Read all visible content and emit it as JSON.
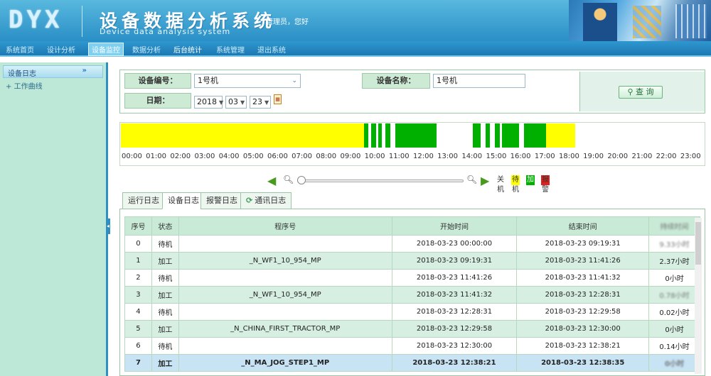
{
  "header": {
    "logo": "DYX",
    "title": "设备数据分析系统",
    "subtitle": "Device data analysis system",
    "greeting": "管理员，您好"
  },
  "nav": {
    "items": [
      "系统首页",
      "设计分析",
      "设备监控",
      "数据分析",
      "后台统计",
      "系统管理",
      "退出系统"
    ],
    "active_index": 2
  },
  "sidebar": {
    "header": "设备日志",
    "items": [
      "工作曲线"
    ]
  },
  "form": {
    "device_no_label": "设备编号：",
    "device_no_value": "1号机",
    "device_name_label": "设备名称：",
    "device_name_value": "1号机",
    "date_label": "日期：",
    "year": "2018",
    "month": "03",
    "day": "23",
    "query_label": "查 询"
  },
  "timeline": {
    "hours": [
      "00:00",
      "01:00",
      "02:00",
      "03:00",
      "04:00",
      "05:00",
      "06:00",
      "07:00",
      "08:00",
      "09:00",
      "10:00",
      "11:00",
      "12:00",
      "13:00",
      "14:00",
      "15:00",
      "16:00",
      "17:00",
      "18:00",
      "19:00",
      "20:00",
      "21:00",
      "22:00",
      "23:00"
    ],
    "segments": [
      {
        "start": 0.0,
        "end": 10.0,
        "state": "待机"
      },
      {
        "start": 10.0,
        "end": 10.2,
        "state": "加工"
      },
      {
        "start": 10.3,
        "end": 10.5,
        "state": "加工"
      },
      {
        "start": 10.6,
        "end": 10.75,
        "state": "加工"
      },
      {
        "start": 10.9,
        "end": 11.1,
        "state": "加工"
      },
      {
        "start": 11.3,
        "end": 11.9,
        "state": "加工"
      },
      {
        "start": 11.9,
        "end": 13.0,
        "state": "加工"
      },
      {
        "start": 14.5,
        "end": 14.8,
        "state": "加工"
      },
      {
        "start": 15.0,
        "end": 15.2,
        "state": "加工"
      },
      {
        "start": 15.4,
        "end": 15.6,
        "state": "加工"
      },
      {
        "start": 15.7,
        "end": 16.4,
        "state": "加工"
      },
      {
        "start": 16.6,
        "end": 17.5,
        "state": "加工"
      },
      {
        "start": 17.5,
        "end": 18.7,
        "state": "待机"
      }
    ],
    "colors": {
      "关机": "#ffffff",
      "待机": "#ffff00",
      "加工": "#00b000",
      "报警": "#e02020"
    }
  },
  "legend": [
    {
      "label": "关机",
      "bg": "#ffffff",
      "color": "#333333"
    },
    {
      "label": "待机",
      "bg": "#ffff00",
      "color": "#333333"
    },
    {
      "label": "加工",
      "bg": "#00b000",
      "color": "#ffffff"
    },
    {
      "label": "报警",
      "bg": "#e02020",
      "color": "#333333"
    }
  ],
  "tabs": [
    {
      "label": "运行日志",
      "active": false
    },
    {
      "label": "设备日志",
      "active": true
    },
    {
      "label": "报警日志",
      "active": false
    },
    {
      "label": "通讯日志",
      "active": false
    }
  ],
  "table": {
    "headers": [
      "序号",
      "状态",
      "程序号",
      "开始时间",
      "结束时间",
      "持续时间"
    ],
    "rows": [
      [
        "0",
        "待机",
        "",
        "2018-03-23 00:00:00",
        "2018-03-23 09:19:31",
        "9.33小时"
      ],
      [
        "1",
        "加工",
        "_N_WF1_10_954_MP",
        "2018-03-23 09:19:31",
        "2018-03-23 11:41:26",
        "2.37小时"
      ],
      [
        "2",
        "待机",
        "",
        "2018-03-23 11:41:26",
        "2018-03-23 11:41:32",
        "0小时"
      ],
      [
        "3",
        "加工",
        "_N_WF1_10_954_MP",
        "2018-03-23 11:41:32",
        "2018-03-23 12:28:31",
        "0.78小时"
      ],
      [
        "4",
        "待机",
        "",
        "2018-03-23 12:28:31",
        "2018-03-23 12:29:58",
        "0.02小时"
      ],
      [
        "5",
        "加工",
        "_N_CHINA_FIRST_TRACTOR_MP",
        "2018-03-23 12:29:58",
        "2018-03-23 12:30:00",
        "0小时"
      ],
      [
        "6",
        "待机",
        "",
        "2018-03-23 12:30:00",
        "2018-03-23 12:38:21",
        "0.14小时"
      ],
      [
        "7",
        "加工",
        "_N_MA_JOG_STEP1_MP",
        "2018-03-23 12:38:21",
        "2018-03-23 12:38:35",
        "0小时"
      ]
    ]
  }
}
